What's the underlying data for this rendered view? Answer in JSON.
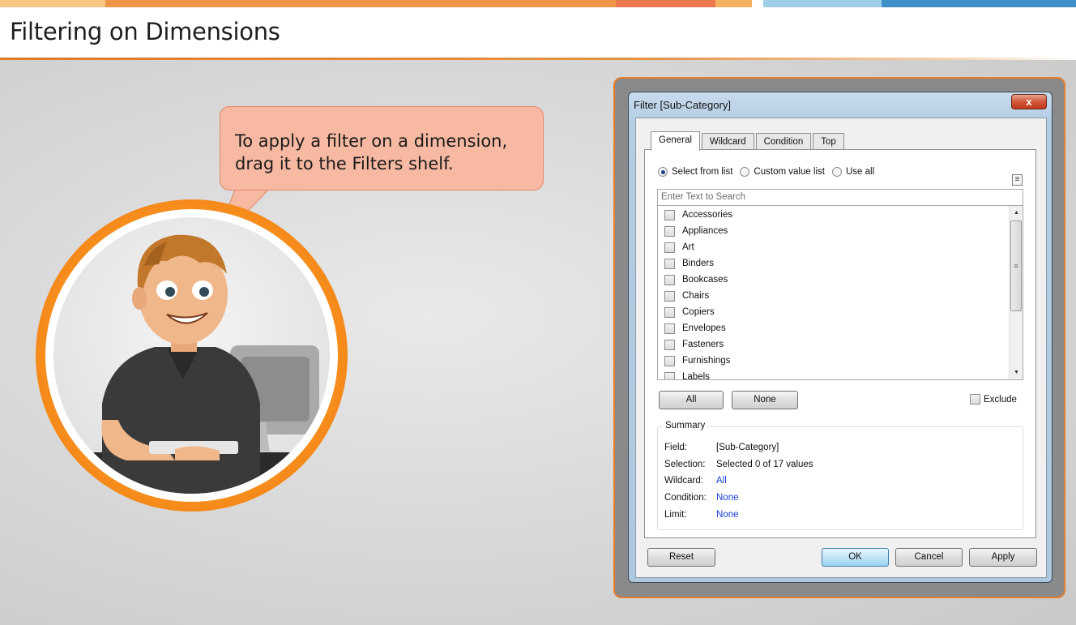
{
  "slide": {
    "title": "Filtering on Dimensions",
    "strip_colors": [
      "#f7c680",
      "#ee9548",
      "#ef8d57",
      "#ea7a4d",
      "#f5b162",
      "#ffffff",
      "#9fcfe6",
      "#3c8fc7"
    ]
  },
  "callout": {
    "line1": "To apply a filter on a dimension,",
    "line2": "drag it to the Filters shelf."
  },
  "dialog": {
    "title": "Filter [Sub-Category]",
    "close_label": "x",
    "tabs": [
      {
        "label": "General"
      },
      {
        "label": "Wildcard"
      },
      {
        "label": "Condition"
      },
      {
        "label": "Top"
      }
    ],
    "radios": {
      "select_from_list": "Select from list",
      "custom_value_list": "Custom value list",
      "use_all": "Use all"
    },
    "search_placeholder": "Enter Text to Search",
    "items": [
      {
        "label": "Accessories"
      },
      {
        "label": "Appliances"
      },
      {
        "label": "Art"
      },
      {
        "label": "Binders"
      },
      {
        "label": "Bookcases"
      },
      {
        "label": "Chairs"
      },
      {
        "label": "Copiers"
      },
      {
        "label": "Envelopes"
      },
      {
        "label": "Fasteners"
      },
      {
        "label": "Furnishings"
      },
      {
        "label": "Labels"
      }
    ],
    "all_label": "All",
    "none_label": "None",
    "exclude_label": "Exclude",
    "summary": {
      "legend": "Summary",
      "field_label": "Field:",
      "field_value": "[Sub-Category]",
      "selection_label": "Selection:",
      "selection_value": "Selected 0 of 17 values",
      "wildcard_label": "Wildcard:",
      "wildcard_value": "All",
      "condition_label": "Condition:",
      "condition_value": "None",
      "limit_label": "Limit:",
      "limit_value": "None"
    },
    "reset_label": "Reset",
    "ok_label": "OK",
    "cancel_label": "Cancel",
    "apply_label": "Apply"
  }
}
